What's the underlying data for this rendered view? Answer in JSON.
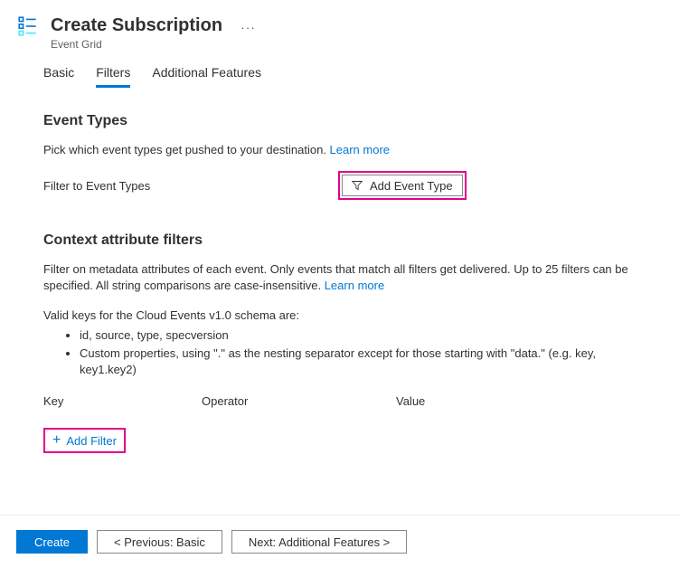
{
  "header": {
    "title": "Create Subscription",
    "subtitle": "Event Grid",
    "more": "···"
  },
  "tabs": {
    "basic": "Basic",
    "filters": "Filters",
    "additional": "Additional Features"
  },
  "eventTypes": {
    "title": "Event Types",
    "desc": "Pick which event types get pushed to your destination. ",
    "learnMore": "Learn more",
    "filterLabel": "Filter to Event Types",
    "addButton": "Add Event Type"
  },
  "contextFilters": {
    "title": "Context attribute filters",
    "desc1": "Filter on metadata attributes of each event. Only events that match all filters get delivered. Up to 25 filters can be specified. All string comparisons are case-insensitive. ",
    "learnMore": "Learn more",
    "validKeysLabel": "Valid keys for the Cloud Events v1.0 schema are:",
    "key1": "id, source, type, specversion",
    "key2": "Custom properties, using \".\" as the nesting separator except for those starting with \"data.\" (e.g. key, key1.key2)",
    "colKey": "Key",
    "colOperator": "Operator",
    "colValue": "Value",
    "addFilter": "Add Filter"
  },
  "footer": {
    "create": "Create",
    "previous": "< Previous: Basic",
    "next": "Next: Additional Features >"
  }
}
